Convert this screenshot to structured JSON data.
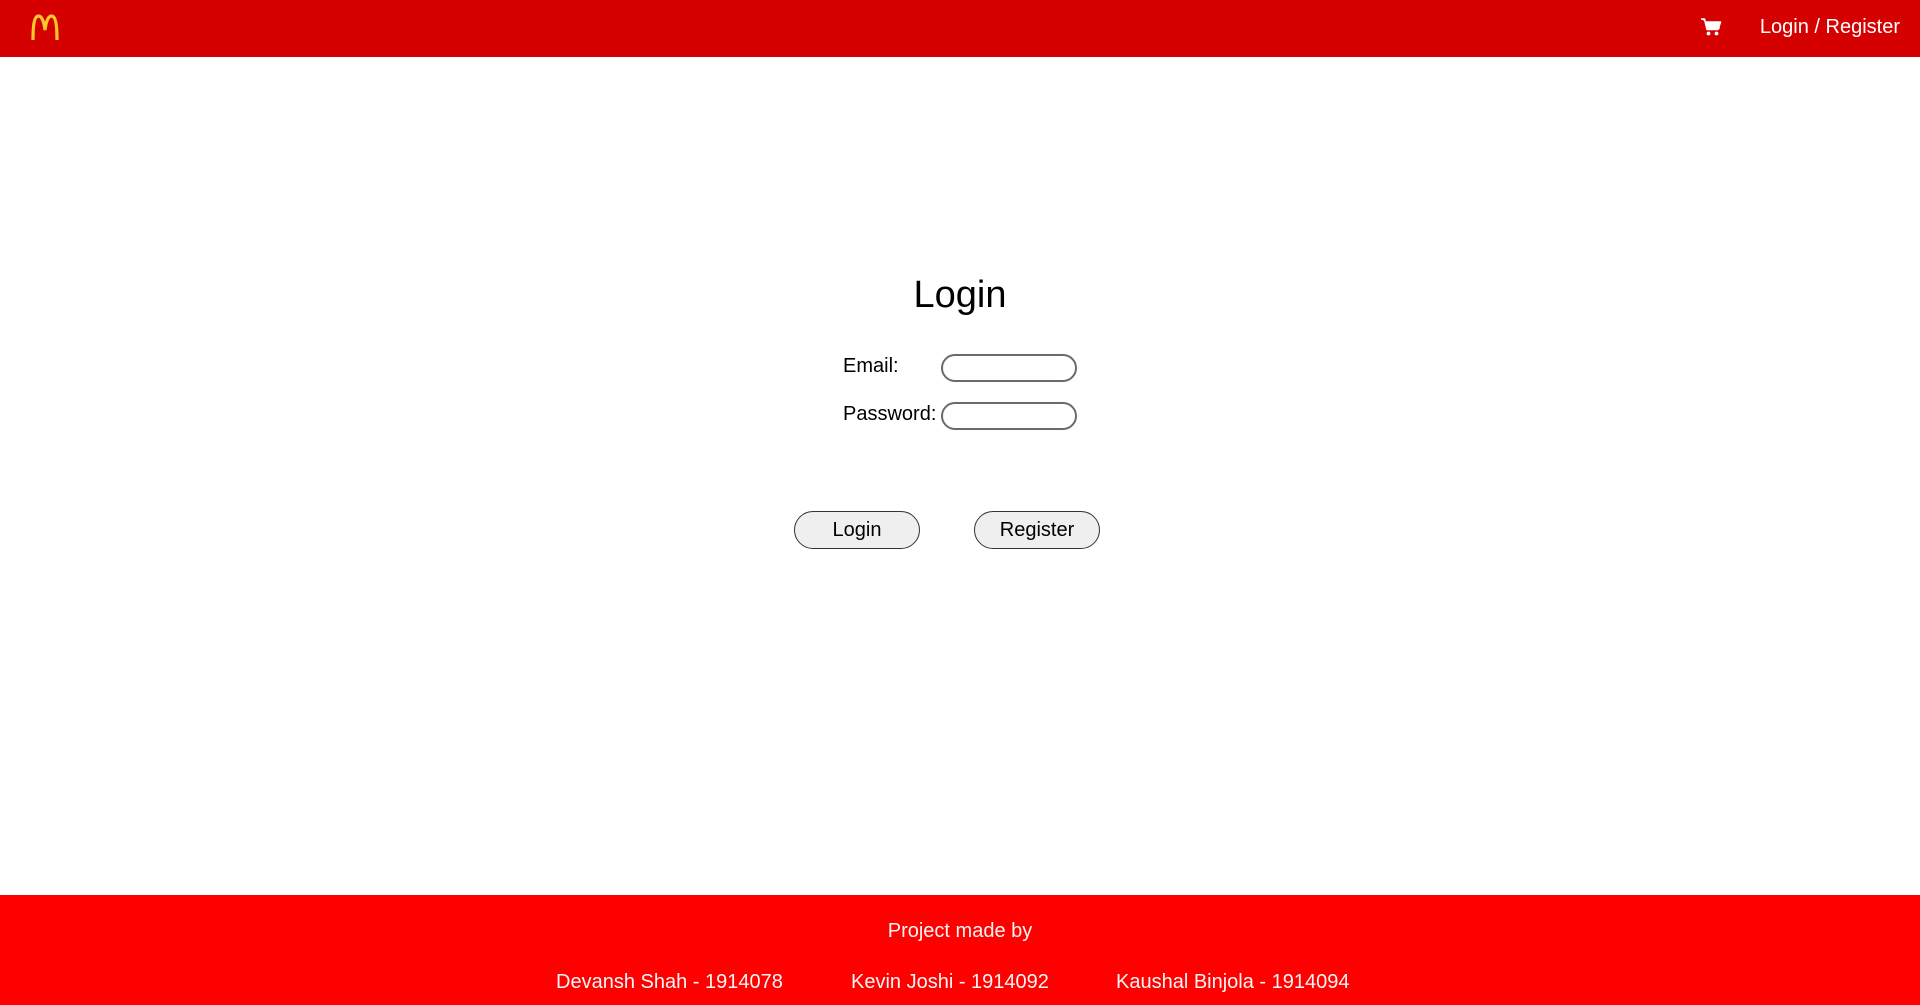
{
  "header": {
    "logo_icon": "mcdonalds-arches-logo",
    "brand_color": "#d50000",
    "logo_color": "#ffc72c",
    "cart_icon": "shopping-cart-icon",
    "auth_link": "Login / Register"
  },
  "form": {
    "title": "Login",
    "email_label": "Email:",
    "email_value": "",
    "password_label": "Password:",
    "password_value": "",
    "login_button": "Login",
    "register_button": "Register"
  },
  "footer": {
    "background_color": "#ff0000",
    "heading": "Project made by",
    "credits": [
      "Devansh Shah - 1914078",
      "Kevin Joshi - 1914092",
      "Kaushal Binjola - 1914094"
    ]
  }
}
